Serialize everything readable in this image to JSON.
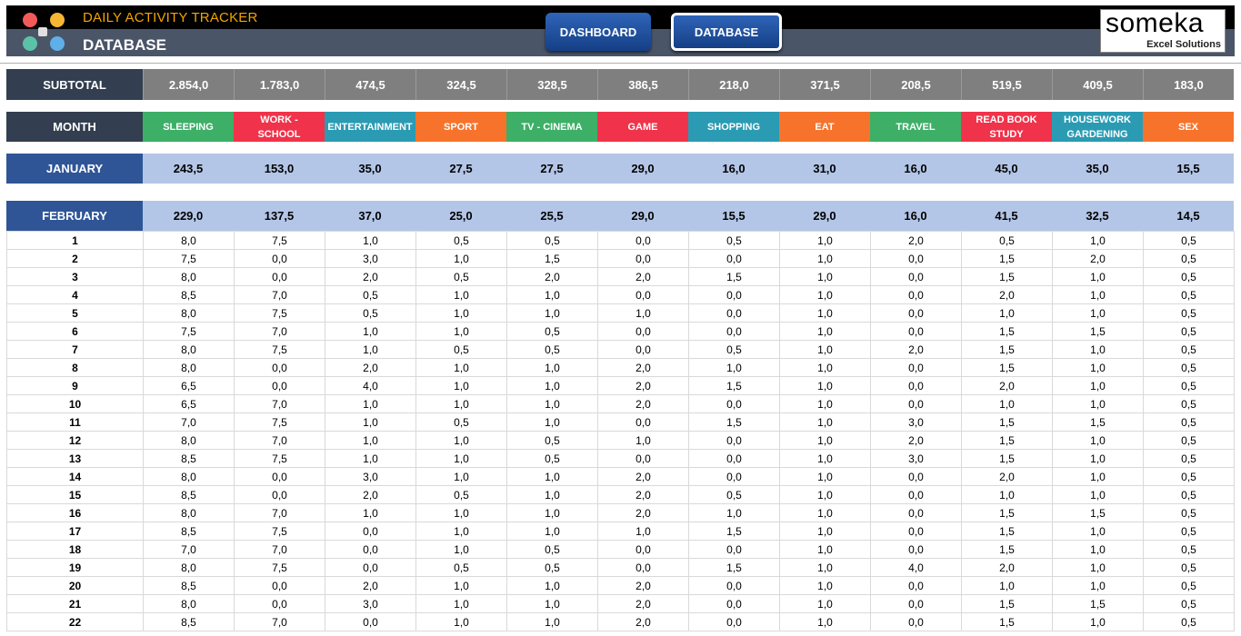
{
  "header": {
    "app_title": "DAILY ACTIVITY TRACKER",
    "page_title": "DATABASE",
    "nav": {
      "dashboard": "DASHBOARD",
      "database": "DATABASE",
      "active": "database"
    },
    "brand": {
      "name": "someka",
      "sub": "Excel Solutions"
    }
  },
  "subtotal": {
    "label": "SUBTOTAL",
    "values": [
      "2.854,0",
      "1.783,0",
      "474,5",
      "324,5",
      "328,5",
      "386,5",
      "218,0",
      "371,5",
      "208,5",
      "519,5",
      "409,5",
      "183,0"
    ]
  },
  "categories": {
    "label": "MONTH",
    "items": [
      {
        "name": "SLEEPING",
        "color": "#3daf67"
      },
      {
        "name": "WORK - SCHOOL",
        "color": "#f0334a"
      },
      {
        "name": "ENTERTAINMENT",
        "color": "#2a9bb3"
      },
      {
        "name": "SPORT",
        "color": "#f7732b"
      },
      {
        "name": "TV - CINEMA",
        "color": "#3daf67"
      },
      {
        "name": "GAME",
        "color": "#f0334a"
      },
      {
        "name": "SHOPPING",
        "color": "#2a9bb3"
      },
      {
        "name": "EAT",
        "color": "#f7732b"
      },
      {
        "name": "TRAVEL",
        "color": "#3daf67"
      },
      {
        "name": "READ BOOK STUDY",
        "color": "#f0334a"
      },
      {
        "name": "HOUSEWORK GARDENING",
        "color": "#2a9bb3"
      },
      {
        "name": "SEX",
        "color": "#f7732b"
      }
    ]
  },
  "january": {
    "label": "JANUARY",
    "values": [
      "243,5",
      "153,0",
      "35,0",
      "27,5",
      "27,5",
      "29,0",
      "16,0",
      "31,0",
      "16,0",
      "45,0",
      "35,0",
      "15,5"
    ]
  },
  "february": {
    "label": "FEBRUARY",
    "values": [
      "229,0",
      "137,5",
      "37,0",
      "25,0",
      "25,5",
      "29,0",
      "15,5",
      "29,0",
      "16,0",
      "41,5",
      "32,5",
      "14,5"
    ]
  },
  "days": [
    {
      "day": "1",
      "values": [
        "8,0",
        "7,5",
        "1,0",
        "0,5",
        "0,5",
        "0,0",
        "0,5",
        "1,0",
        "2,0",
        "0,5",
        "1,0",
        "0,5"
      ]
    },
    {
      "day": "2",
      "values": [
        "7,5",
        "0,0",
        "3,0",
        "1,0",
        "1,5",
        "0,0",
        "0,0",
        "1,0",
        "0,0",
        "1,5",
        "2,0",
        "0,5"
      ]
    },
    {
      "day": "3",
      "values": [
        "8,0",
        "0,0",
        "2,0",
        "0,5",
        "2,0",
        "2,0",
        "1,5",
        "1,0",
        "0,0",
        "1,5",
        "1,0",
        "0,5"
      ]
    },
    {
      "day": "4",
      "values": [
        "8,5",
        "7,0",
        "0,5",
        "1,0",
        "1,0",
        "0,0",
        "0,0",
        "1,0",
        "0,0",
        "2,0",
        "1,0",
        "0,5"
      ]
    },
    {
      "day": "5",
      "values": [
        "8,0",
        "7,5",
        "0,5",
        "1,0",
        "1,0",
        "1,0",
        "0,0",
        "1,0",
        "0,0",
        "1,0",
        "1,0",
        "0,5"
      ]
    },
    {
      "day": "6",
      "values": [
        "7,5",
        "7,0",
        "1,0",
        "1,0",
        "0,5",
        "0,0",
        "0,0",
        "1,0",
        "0,0",
        "1,5",
        "1,5",
        "0,5"
      ]
    },
    {
      "day": "7",
      "values": [
        "8,0",
        "7,5",
        "1,0",
        "0,5",
        "0,5",
        "0,0",
        "0,5",
        "1,0",
        "2,0",
        "1,5",
        "1,0",
        "0,5"
      ]
    },
    {
      "day": "8",
      "values": [
        "8,0",
        "0,0",
        "2,0",
        "1,0",
        "1,0",
        "2,0",
        "1,0",
        "1,0",
        "0,0",
        "1,5",
        "1,0",
        "0,5"
      ]
    },
    {
      "day": "9",
      "values": [
        "6,5",
        "0,0",
        "4,0",
        "1,0",
        "1,0",
        "2,0",
        "1,5",
        "1,0",
        "0,0",
        "2,0",
        "1,0",
        "0,5"
      ]
    },
    {
      "day": "10",
      "values": [
        "6,5",
        "7,0",
        "1,0",
        "1,0",
        "1,0",
        "2,0",
        "0,0",
        "1,0",
        "0,0",
        "1,0",
        "1,0",
        "0,5"
      ]
    },
    {
      "day": "11",
      "values": [
        "7,0",
        "7,5",
        "1,0",
        "0,5",
        "1,0",
        "0,0",
        "1,5",
        "1,0",
        "3,0",
        "1,5",
        "1,5",
        "0,5"
      ]
    },
    {
      "day": "12",
      "values": [
        "8,0",
        "7,0",
        "1,0",
        "1,0",
        "0,5",
        "1,0",
        "0,0",
        "1,0",
        "2,0",
        "1,5",
        "1,0",
        "0,5"
      ]
    },
    {
      "day": "13",
      "values": [
        "8,5",
        "7,5",
        "1,0",
        "1,0",
        "0,5",
        "0,0",
        "0,0",
        "1,0",
        "3,0",
        "1,5",
        "1,0",
        "0,5"
      ]
    },
    {
      "day": "14",
      "values": [
        "8,0",
        "0,0",
        "3,0",
        "1,0",
        "1,0",
        "2,0",
        "0,0",
        "1,0",
        "0,0",
        "2,0",
        "1,0",
        "0,5"
      ]
    },
    {
      "day": "15",
      "values": [
        "8,5",
        "0,0",
        "2,0",
        "0,5",
        "1,0",
        "2,0",
        "0,5",
        "1,0",
        "0,0",
        "1,0",
        "1,0",
        "0,5"
      ]
    },
    {
      "day": "16",
      "values": [
        "8,0",
        "7,0",
        "1,0",
        "1,0",
        "1,0",
        "2,0",
        "1,0",
        "1,0",
        "0,0",
        "1,5",
        "1,5",
        "0,5"
      ]
    },
    {
      "day": "17",
      "values": [
        "8,5",
        "7,5",
        "0,0",
        "1,0",
        "1,0",
        "1,0",
        "1,5",
        "1,0",
        "0,0",
        "1,5",
        "1,0",
        "0,5"
      ]
    },
    {
      "day": "18",
      "values": [
        "7,0",
        "7,0",
        "0,0",
        "1,0",
        "0,5",
        "0,0",
        "0,0",
        "1,0",
        "0,0",
        "1,5",
        "1,0",
        "0,5"
      ]
    },
    {
      "day": "19",
      "values": [
        "8,0",
        "7,5",
        "0,0",
        "0,5",
        "0,5",
        "0,0",
        "1,5",
        "1,0",
        "4,0",
        "2,0",
        "1,0",
        "0,5"
      ]
    },
    {
      "day": "20",
      "values": [
        "8,5",
        "0,0",
        "2,0",
        "1,0",
        "1,0",
        "2,0",
        "0,0",
        "1,0",
        "0,0",
        "1,0",
        "1,0",
        "0,5"
      ]
    },
    {
      "day": "21",
      "values": [
        "8,0",
        "0,0",
        "3,0",
        "1,0",
        "1,0",
        "2,0",
        "0,0",
        "1,0",
        "0,0",
        "1,5",
        "1,5",
        "0,5"
      ]
    },
    {
      "day": "22",
      "values": [
        "8,5",
        "7,0",
        "0,0",
        "1,0",
        "1,0",
        "2,0",
        "0,0",
        "1,0",
        "0,0",
        "1,5",
        "1,0",
        "0,5"
      ]
    }
  ],
  "colors": {
    "header_dark": "#000000",
    "header_slate": "#4a5568",
    "title_orange": "#f4a300",
    "month_blue": "#2f5597",
    "month_light": "#b4c6e7",
    "subtotal_gray": "#7f7f7f"
  }
}
